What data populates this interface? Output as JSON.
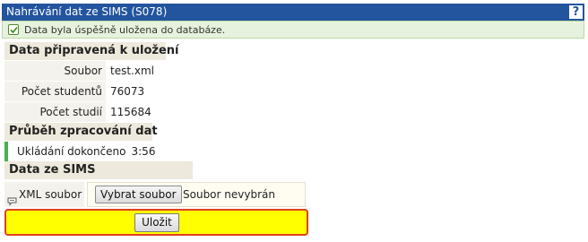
{
  "header": {
    "title": "Nahrávání dat ze SIMS (S078)",
    "help_icon": "question-mark-icon",
    "help_label": "?",
    "background": "#23549e"
  },
  "message": {
    "icon": "check-icon",
    "text": "Data byla úspěšně uložena do databáze.",
    "color": "#4caf50"
  },
  "prepared": {
    "heading": "Data připravená k uložení",
    "rows": [
      {
        "label": "Soubor",
        "value": "test.xml"
      },
      {
        "label": "Počet studentů",
        "value": "76073"
      },
      {
        "label": "Počet studií",
        "value": "115684"
      }
    ]
  },
  "progress": {
    "heading": "Průběh zpracování dat",
    "status": "Ukládání dokončeno",
    "time": "3:56"
  },
  "sims": {
    "heading": "Data ze SIMS",
    "field_icon": "speech-bubble-icon",
    "field_label": "XML soubor",
    "choose_button": "Vybrat soubor",
    "file_status": "Soubor nevybrán"
  },
  "actions": {
    "save_label": "Uložit",
    "highlight_color": "#ffff00",
    "border_color": "#e04020"
  }
}
